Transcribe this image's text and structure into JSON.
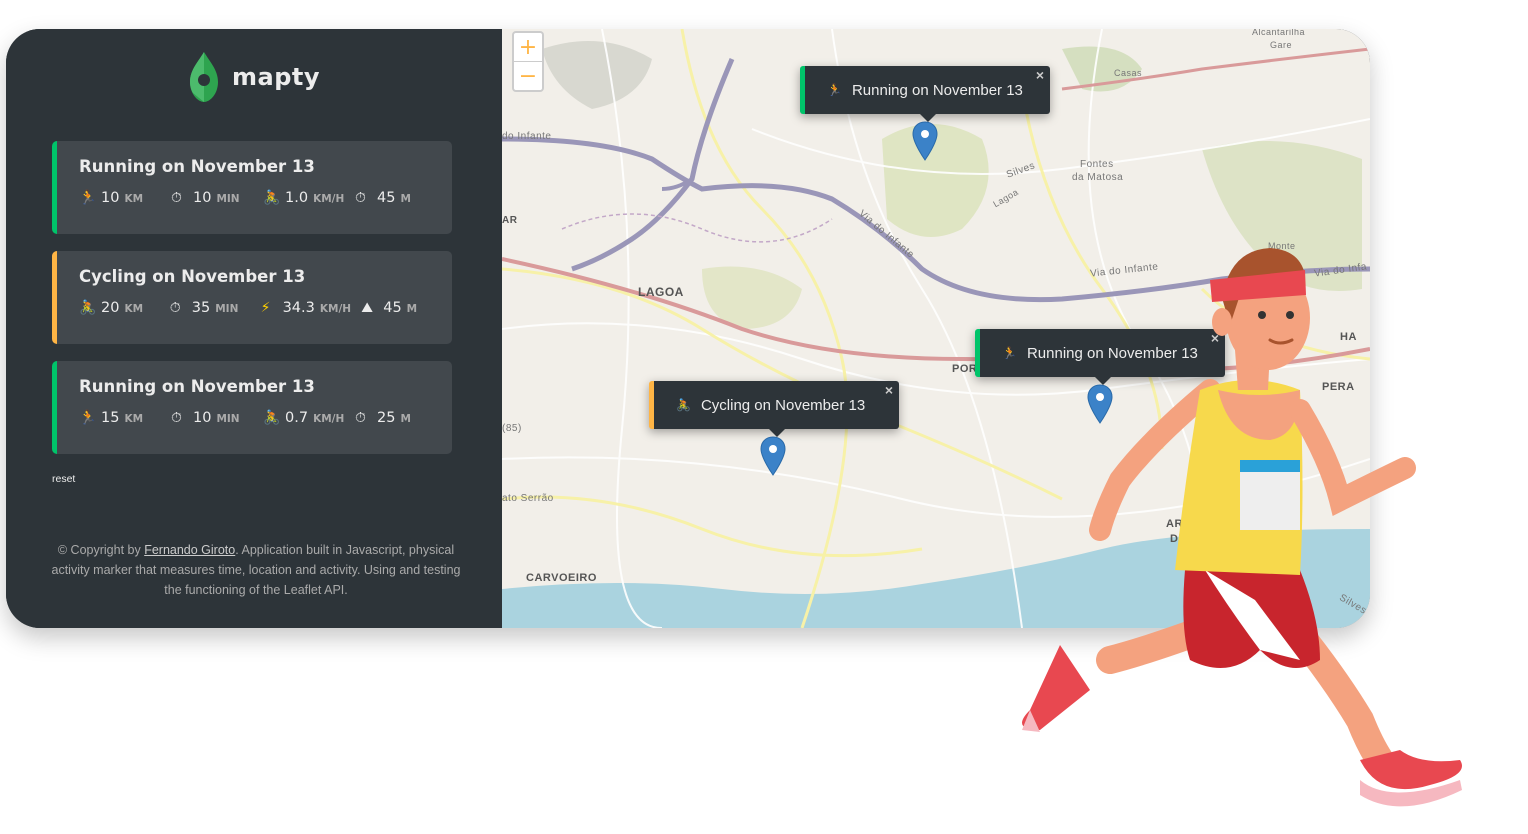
{
  "app": {
    "logo_text": "mapty"
  },
  "workouts": [
    {
      "type": "running",
      "title": "Running on November 13",
      "details": [
        {
          "icon": "running-icon",
          "glyph": "🏃",
          "value": "10",
          "unit": "km"
        },
        {
          "icon": "stopwatch-icon",
          "glyph": "⏱",
          "value": "10",
          "unit": "min"
        },
        {
          "icon": "cyclist-icon",
          "glyph": "🚴",
          "value": "1.0",
          "unit": "km/h"
        },
        {
          "icon": "stopwatch-icon",
          "glyph": "⏱",
          "value": "45",
          "unit": "m"
        }
      ]
    },
    {
      "type": "cycling",
      "title": "Cycling on November 13",
      "details": [
        {
          "icon": "cyclist-icon",
          "glyph": "🚴",
          "value": "20",
          "unit": "km"
        },
        {
          "icon": "stopwatch-icon",
          "glyph": "⏱",
          "value": "35",
          "unit": "min"
        },
        {
          "icon": "lightning-icon",
          "glyph": "⚡",
          "value": "34.3",
          "unit": "km/h"
        },
        {
          "icon": "mountain-icon",
          "glyph": "⛰",
          "value": "45",
          "unit": "m"
        }
      ]
    },
    {
      "type": "running",
      "title": "Running on November 13",
      "details": [
        {
          "icon": "running-icon",
          "glyph": "🏃",
          "value": "15",
          "unit": "km"
        },
        {
          "icon": "stopwatch-icon",
          "glyph": "⏱",
          "value": "10",
          "unit": "min"
        },
        {
          "icon": "cyclist-icon",
          "glyph": "🚴",
          "value": "0.7",
          "unit": "km/h"
        },
        {
          "icon": "stopwatch-icon",
          "glyph": "⏱",
          "value": "25",
          "unit": "m"
        }
      ]
    }
  ],
  "reset_label": "reset",
  "copyright": {
    "prefix": "© Copyright by ",
    "author": "Fernando Giroto",
    "suffix": ". Application built in Javascript, physical activity marker that measures time, location and activity. Using and testing the functioning of the Leaflet API."
  },
  "map": {
    "zoom_in": "+",
    "zoom_out": "−",
    "labels": {
      "lagoa": "LAGOA",
      "carvoeiro": "CARVOEIRO",
      "pera": "PERA",
      "por": "POR",
      "arm": "ARM",
      "de": "DE",
      "ha": "HA",
      "do_infante_left": "do Infante",
      "via_do_infante_1": "Via do Infante",
      "via_do_infante_2": "Via do Infante",
      "via_do_infa": "Via do Infa",
      "silves": "Silves",
      "lagoa_small": "Lagoa",
      "fontes": "Fontes",
      "da_matosa": "da Matosa",
      "casas": "Casas",
      "alcantarilha": "Alcantarilha",
      "gare": "Gare",
      "monte": "Monte",
      "mato_serrao": "ato Serrão",
      "silves_coast": "Silves",
      "ar": "AR",
      "num85": "(85)"
    },
    "popups": [
      {
        "type": "running",
        "glyph": "🏃",
        "text": "Running on November 13",
        "close": "×"
      },
      {
        "type": "running",
        "glyph": "🏃",
        "text": "Running on November 13",
        "close": "×"
      },
      {
        "type": "cycling",
        "glyph": "🚴",
        "text": "Cycling on November 13",
        "close": "×"
      }
    ]
  },
  "colors": {
    "running_accent": "#00c46a",
    "cycling_accent": "#ffb545",
    "sidebar_bg": "#2d3439",
    "card_bg": "#42484d"
  }
}
